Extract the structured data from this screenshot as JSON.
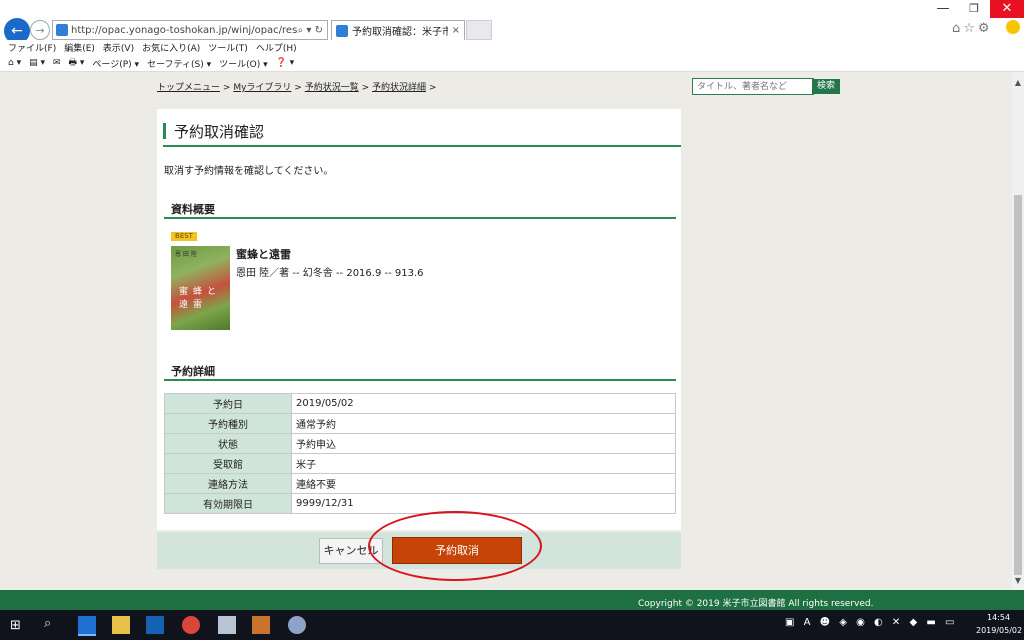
{
  "browser": {
    "url": "http://opac.yonago-toshokan.jp/winj/opac/reserve-list.do",
    "tab_title": "予約取消確認：米子市立図...",
    "tab_close": "×",
    "address_controls": "⌕ ▾ ↻",
    "menu": [
      "ファイル(F)",
      "編集(E)",
      "表示(V)",
      "お気に入り(A)",
      "ツール(T)",
      "ヘルプ(H)"
    ],
    "commands": [
      "⌂ ▾",
      "▤ ▾",
      "✉",
      "🖶 ▾",
      "ページ(P) ▾",
      "セーフティ(S) ▾",
      "ツール(O) ▾",
      "❓ ▾"
    ],
    "window_controls": {
      "minimize": "—",
      "restore": "❐",
      "close": "✕"
    },
    "right_icons": "⌂☆⚙"
  },
  "breadcrumb": {
    "items": [
      "トップメニュー",
      "Myライブラリ",
      "予約状況一覧",
      "予約状況詳細"
    ],
    "separator": ">"
  },
  "search": {
    "placeholder": "タイトル、著者名など",
    "button": "検索"
  },
  "page": {
    "title": "予約取消確認",
    "intro": "取消す予約情報を確認してください。",
    "section_overview": "資料概要",
    "badge": "BEST",
    "book": {
      "title": "蜜蜂と遠雷",
      "meta": "恩田 陸／著 -- 幻冬舎 -- 2016.9 -- 913.6"
    },
    "section_detail": "予約詳細",
    "details": [
      {
        "label": "予約日",
        "value": "2019/05/02"
      },
      {
        "label": "予約種別",
        "value": "通常予約"
      },
      {
        "label": "状態",
        "value": "予約申込"
      },
      {
        "label": "受取館",
        "value": "米子"
      },
      {
        "label": "連絡方法",
        "value": "連絡不要"
      },
      {
        "label": "有効期限日",
        "value": "9999/12/31"
      }
    ],
    "cancel_label": "キャンセル",
    "confirm_label": "予約取消"
  },
  "footer": {
    "copyright": "Copyright © 2019 米子市立図書館 All rights reserved."
  },
  "taskbar": {
    "time": "14:54",
    "date": "2019/05/02"
  },
  "colors": {
    "accent": "#2a8b55",
    "button": "#c64407",
    "highlight": "#d8141c",
    "footer": "#1e7043"
  }
}
